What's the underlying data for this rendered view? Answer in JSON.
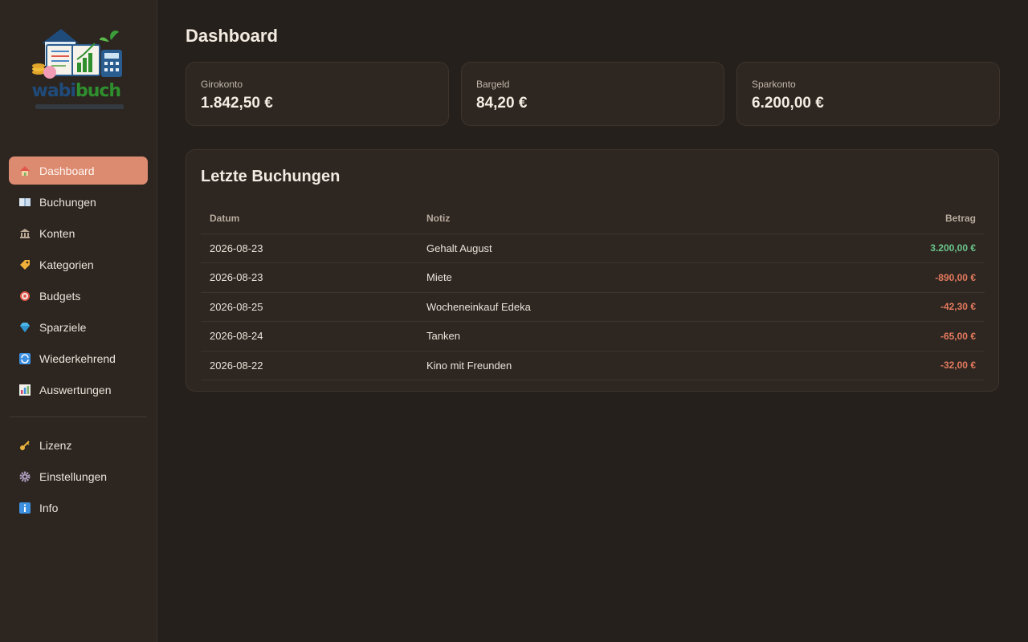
{
  "app": {
    "logo": {
      "word_part1": "wabi",
      "word_part2": "buch"
    }
  },
  "sidebar": {
    "items": [
      {
        "label": "Dashboard",
        "icon": "home-icon",
        "active": true,
        "color": "#7bb36a"
      },
      {
        "label": "Buchungen",
        "icon": "book-icon",
        "active": false,
        "color": "#9ec4e8"
      },
      {
        "label": "Konten",
        "icon": "bank-icon",
        "active": false,
        "color": "#b9a896"
      },
      {
        "label": "Kategorien",
        "icon": "tag-icon",
        "active": false,
        "color": "#f0b13a"
      },
      {
        "label": "Budgets",
        "icon": "target-icon",
        "active": false,
        "color": "#e2574c"
      },
      {
        "label": "Sparziele",
        "icon": "gem-icon",
        "active": false,
        "color": "#4fb6e8"
      },
      {
        "label": "Wiederkehrend",
        "icon": "repeat-icon",
        "active": false,
        "color": "#3d8fe0"
      },
      {
        "label": "Auswertungen",
        "icon": "chart-icon",
        "active": false,
        "color": "#cf4f6b"
      }
    ],
    "secondary": [
      {
        "label": "Lizenz",
        "icon": "key-icon",
        "color": "#e8b33c"
      },
      {
        "label": "Einstellungen",
        "icon": "gear-icon",
        "color": "#a99ab8"
      },
      {
        "label": "Info",
        "icon": "info-icon",
        "color": "#3d8fe0"
      }
    ]
  },
  "main": {
    "title": "Dashboard",
    "accounts": [
      {
        "label": "Girokonto",
        "value": "1.842,50 €"
      },
      {
        "label": "Bargeld",
        "value": "84,20 €"
      },
      {
        "label": "Sparkonto",
        "value": "6.200,00 €"
      }
    ],
    "recent": {
      "title": "Letzte Buchungen",
      "columns": {
        "date": "Datum",
        "note": "Notiz",
        "amount": "Betrag"
      },
      "rows": [
        {
          "date": "2026-08-23",
          "note": "Gehalt August",
          "amount": "3.200,00 €",
          "sign": "pos"
        },
        {
          "date": "2026-08-23",
          "note": "Miete",
          "amount": "-890,00 €",
          "sign": "neg"
        },
        {
          "date": "2026-08-25",
          "note": "Wocheneinkauf Edeka",
          "amount": "-42,30 €",
          "sign": "neg"
        },
        {
          "date": "2026-08-24",
          "note": "Tanken",
          "amount": "-65,00 €",
          "sign": "neg"
        },
        {
          "date": "2026-08-22",
          "note": "Kino mit Freunden",
          "amount": "-32,00 €",
          "sign": "neg"
        }
      ]
    }
  },
  "colors": {
    "accent": "#dc8a70",
    "positive": "#6bc58a",
    "negative": "#e47a5e",
    "background": "#25201b",
    "sidebar": "#2c2520"
  }
}
